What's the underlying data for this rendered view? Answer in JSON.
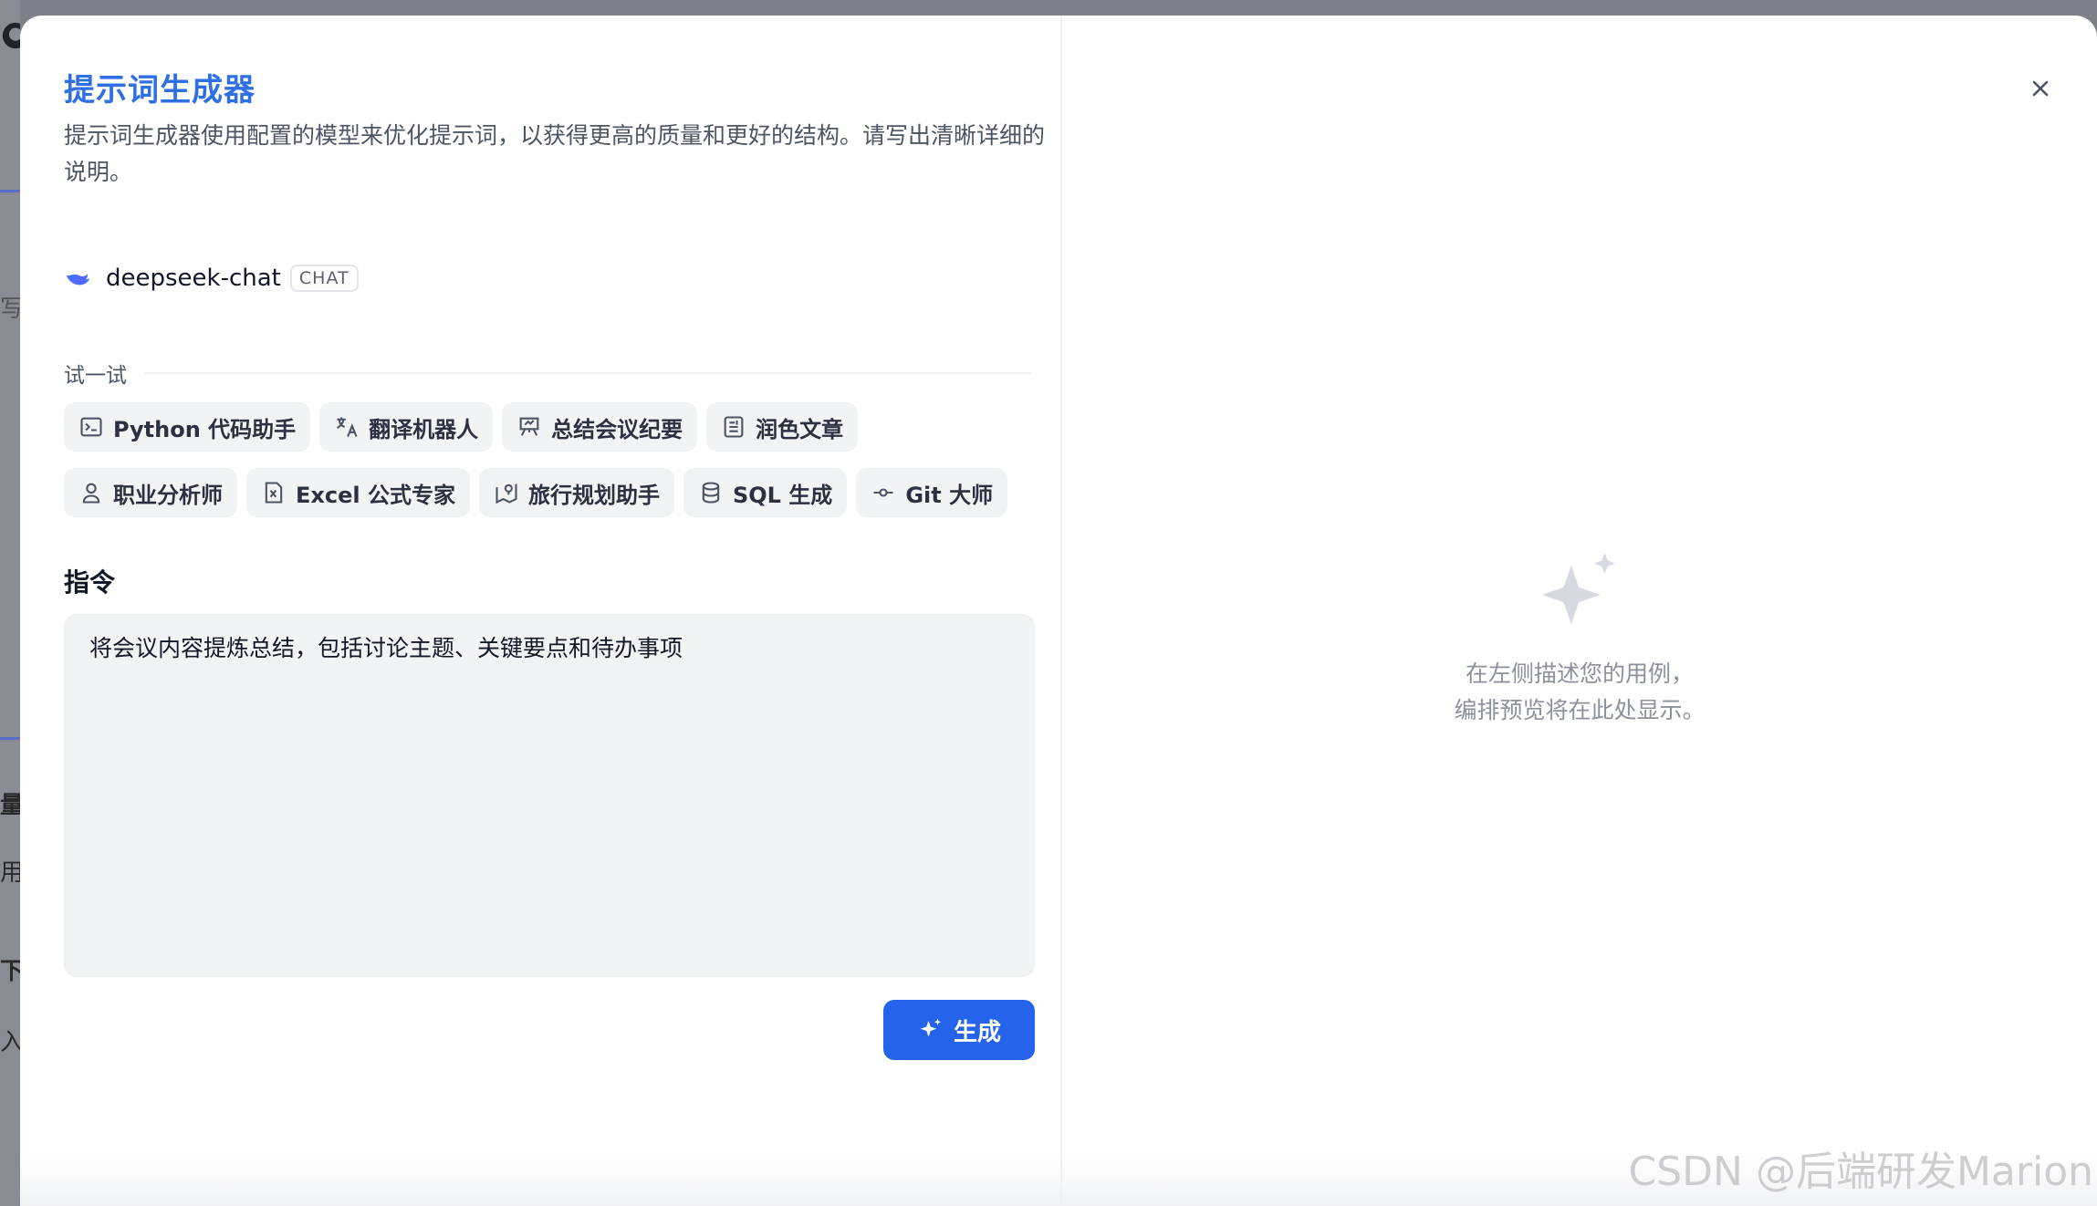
{
  "background": {
    "fragments": [
      "写",
      "量",
      "用",
      "下",
      "入"
    ]
  },
  "dialog": {
    "title": "提示词生成器",
    "description": "提示词生成器使用配置的模型来优化提示词，以获得更高的质量和更好的结构。请写出清晰详细的说明。",
    "model": {
      "name": "deepseek-chat",
      "badge": "CHAT",
      "icon": "deepseek-whale-icon"
    },
    "try_label": "试一试",
    "templates_row1": [
      {
        "label": "Python 代码助手",
        "icon": "terminal-icon"
      },
      {
        "label": "翻译机器人",
        "icon": "translate-icon"
      },
      {
        "label": "总结会议纪要",
        "icon": "presentation-icon"
      },
      {
        "label": "润色文章",
        "icon": "article-icon"
      }
    ],
    "templates_row2": [
      {
        "label": "职业分析师",
        "icon": "user-icon"
      },
      {
        "label": "Excel 公式专家",
        "icon": "excel-icon"
      },
      {
        "label": "旅行规划助手",
        "icon": "map-pin-icon"
      },
      {
        "label": "SQL 生成",
        "icon": "database-icon"
      },
      {
        "label": "Git 大师",
        "icon": "git-commit-icon"
      }
    ],
    "instruction_label": "指令",
    "instruction_value": "将会议内容提炼总结，包括讨论主题、关键要点和待办事项",
    "generate_label": "生成",
    "empty_state": {
      "line1": "在左侧描述您的用例，",
      "line2": "编排预览将在此处显示。"
    }
  },
  "watermark": "CSDN @后端研发Marion",
  "colors": {
    "accent": "#2563eb",
    "title": "#2f6fe6"
  }
}
